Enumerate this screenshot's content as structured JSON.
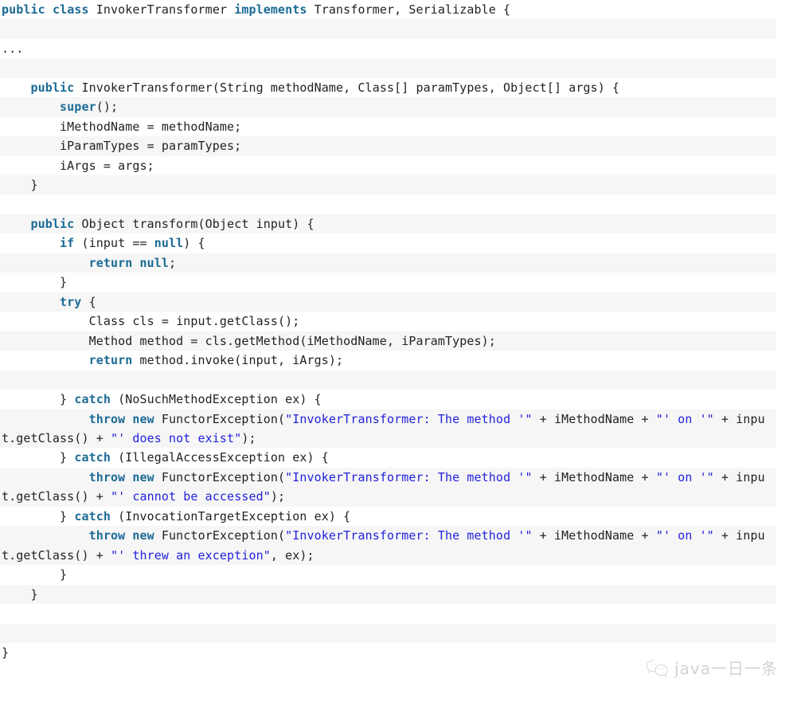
{
  "document": {
    "language": "Java",
    "class_name": "InvokerTransformer",
    "colors": {
      "keyword": "#1c6b96",
      "string": "#2222dd",
      "text": "#222222",
      "background": "#ffffff",
      "stripe": "#f6f6f6"
    }
  },
  "watermark": {
    "icon": "wechat-icon",
    "text": "java一日一条"
  },
  "lines": [
    {
      "stripe": false,
      "wrapped": false,
      "tokens": [
        {
          "t": "kw",
          "v": "public"
        },
        {
          "t": "txt",
          "v": " "
        },
        {
          "t": "kw",
          "v": "class"
        },
        {
          "t": "txt",
          "v": " InvokerTransformer "
        },
        {
          "t": "kw",
          "v": "implements"
        },
        {
          "t": "txt",
          "v": " Transformer, Serializable {"
        }
      ]
    },
    {
      "stripe": true,
      "wrapped": false,
      "tokens": [
        {
          "t": "txt",
          "v": ""
        }
      ]
    },
    {
      "stripe": false,
      "wrapped": false,
      "tokens": [
        {
          "t": "txt",
          "v": "..."
        }
      ]
    },
    {
      "stripe": true,
      "wrapped": false,
      "tokens": [
        {
          "t": "txt",
          "v": ""
        }
      ]
    },
    {
      "stripe": false,
      "wrapped": false,
      "tokens": [
        {
          "t": "txt",
          "v": "    "
        },
        {
          "t": "kw",
          "v": "public"
        },
        {
          "t": "txt",
          "v": " InvokerTransformer(String methodName, Class[] paramTypes, Object[] args) {"
        }
      ]
    },
    {
      "stripe": true,
      "wrapped": false,
      "tokens": [
        {
          "t": "txt",
          "v": "        "
        },
        {
          "t": "kw",
          "v": "super"
        },
        {
          "t": "txt",
          "v": "();"
        }
      ]
    },
    {
      "stripe": false,
      "wrapped": false,
      "tokens": [
        {
          "t": "txt",
          "v": "        iMethodName = methodName;"
        }
      ]
    },
    {
      "stripe": true,
      "wrapped": false,
      "tokens": [
        {
          "t": "txt",
          "v": "        iParamTypes = paramTypes;"
        }
      ]
    },
    {
      "stripe": false,
      "wrapped": false,
      "tokens": [
        {
          "t": "txt",
          "v": "        iArgs = args;"
        }
      ]
    },
    {
      "stripe": true,
      "wrapped": false,
      "tokens": [
        {
          "t": "txt",
          "v": "    }"
        }
      ]
    },
    {
      "stripe": false,
      "wrapped": false,
      "tokens": [
        {
          "t": "txt",
          "v": ""
        }
      ]
    },
    {
      "stripe": true,
      "wrapped": false,
      "tokens": [
        {
          "t": "txt",
          "v": "    "
        },
        {
          "t": "kw",
          "v": "public"
        },
        {
          "t": "txt",
          "v": " Object transform(Object input) {"
        }
      ]
    },
    {
      "stripe": false,
      "wrapped": false,
      "tokens": [
        {
          "t": "txt",
          "v": "        "
        },
        {
          "t": "kw",
          "v": "if"
        },
        {
          "t": "txt",
          "v": " (input == "
        },
        {
          "t": "kw",
          "v": "null"
        },
        {
          "t": "txt",
          "v": ") {"
        }
      ]
    },
    {
      "stripe": true,
      "wrapped": false,
      "tokens": [
        {
          "t": "txt",
          "v": "            "
        },
        {
          "t": "kw",
          "v": "return"
        },
        {
          "t": "txt",
          "v": " "
        },
        {
          "t": "kw",
          "v": "null"
        },
        {
          "t": "txt",
          "v": ";"
        }
      ]
    },
    {
      "stripe": false,
      "wrapped": false,
      "tokens": [
        {
          "t": "txt",
          "v": "        }"
        }
      ]
    },
    {
      "stripe": true,
      "wrapped": false,
      "tokens": [
        {
          "t": "txt",
          "v": "        "
        },
        {
          "t": "kw",
          "v": "try"
        },
        {
          "t": "txt",
          "v": " {"
        }
      ]
    },
    {
      "stripe": false,
      "wrapped": false,
      "tokens": [
        {
          "t": "txt",
          "v": "            Class cls = input.getClass();"
        }
      ]
    },
    {
      "stripe": true,
      "wrapped": false,
      "tokens": [
        {
          "t": "txt",
          "v": "            Method method = cls.getMethod(iMethodName, iParamTypes);"
        }
      ]
    },
    {
      "stripe": false,
      "wrapped": false,
      "tokens": [
        {
          "t": "txt",
          "v": "            "
        },
        {
          "t": "kw",
          "v": "return"
        },
        {
          "t": "txt",
          "v": " method.invoke(input, iArgs);"
        }
      ]
    },
    {
      "stripe": true,
      "wrapped": false,
      "tokens": [
        {
          "t": "txt",
          "v": ""
        }
      ]
    },
    {
      "stripe": false,
      "wrapped": false,
      "tokens": [
        {
          "t": "txt",
          "v": "        } "
        },
        {
          "t": "kw",
          "v": "catch"
        },
        {
          "t": "txt",
          "v": " (NoSuchMethodException ex) {"
        }
      ]
    },
    {
      "stripe": true,
      "wrapped": true,
      "tokens": [
        {
          "t": "txt",
          "v": "            "
        },
        {
          "t": "kw",
          "v": "throw"
        },
        {
          "t": "txt",
          "v": " "
        },
        {
          "t": "kw",
          "v": "new"
        },
        {
          "t": "txt",
          "v": " FunctorException("
        },
        {
          "t": "str",
          "v": "\"InvokerTransformer: The method '\""
        },
        {
          "t": "txt",
          "v": " + iMethodName + "
        },
        {
          "t": "str",
          "v": "\"' on '\""
        },
        {
          "t": "txt",
          "v": " + input.getClass() + "
        },
        {
          "t": "str",
          "v": "\"' does not exist\""
        },
        {
          "t": "txt",
          "v": ");"
        }
      ]
    },
    {
      "stripe": false,
      "wrapped": false,
      "tokens": [
        {
          "t": "txt",
          "v": "        } "
        },
        {
          "t": "kw",
          "v": "catch"
        },
        {
          "t": "txt",
          "v": " (IllegalAccessException ex) {"
        }
      ]
    },
    {
      "stripe": true,
      "wrapped": true,
      "tokens": [
        {
          "t": "txt",
          "v": "            "
        },
        {
          "t": "kw",
          "v": "throw"
        },
        {
          "t": "txt",
          "v": " "
        },
        {
          "t": "kw",
          "v": "new"
        },
        {
          "t": "txt",
          "v": " FunctorException("
        },
        {
          "t": "str",
          "v": "\"InvokerTransformer: The method '\""
        },
        {
          "t": "txt",
          "v": " + iMethodName + "
        },
        {
          "t": "str",
          "v": "\"' on '\""
        },
        {
          "t": "txt",
          "v": " + input.getClass() + "
        },
        {
          "t": "str",
          "v": "\"' cannot be accessed\""
        },
        {
          "t": "txt",
          "v": ");"
        }
      ]
    },
    {
      "stripe": false,
      "wrapped": false,
      "tokens": [
        {
          "t": "txt",
          "v": "        } "
        },
        {
          "t": "kw",
          "v": "catch"
        },
        {
          "t": "txt",
          "v": " (InvocationTargetException ex) {"
        }
      ]
    },
    {
      "stripe": true,
      "wrapped": true,
      "tokens": [
        {
          "t": "txt",
          "v": "            "
        },
        {
          "t": "kw",
          "v": "throw"
        },
        {
          "t": "txt",
          "v": " "
        },
        {
          "t": "kw",
          "v": "new"
        },
        {
          "t": "txt",
          "v": " FunctorException("
        },
        {
          "t": "str",
          "v": "\"InvokerTransformer: The method '\""
        },
        {
          "t": "txt",
          "v": " + iMethodName + "
        },
        {
          "t": "str",
          "v": "\"' on '\""
        },
        {
          "t": "txt",
          "v": " + input.getClass() + "
        },
        {
          "t": "str",
          "v": "\"' threw an exception\""
        },
        {
          "t": "txt",
          "v": ", ex);"
        }
      ]
    },
    {
      "stripe": false,
      "wrapped": false,
      "tokens": [
        {
          "t": "txt",
          "v": "        }"
        }
      ]
    },
    {
      "stripe": true,
      "wrapped": false,
      "tokens": [
        {
          "t": "txt",
          "v": "    }"
        }
      ]
    },
    {
      "stripe": false,
      "wrapped": false,
      "tokens": [
        {
          "t": "txt",
          "v": ""
        }
      ]
    },
    {
      "stripe": true,
      "wrapped": false,
      "tokens": [
        {
          "t": "txt",
          "v": ""
        }
      ]
    },
    {
      "stripe": false,
      "wrapped": false,
      "tokens": [
        {
          "t": "txt",
          "v": "}"
        }
      ]
    }
  ]
}
